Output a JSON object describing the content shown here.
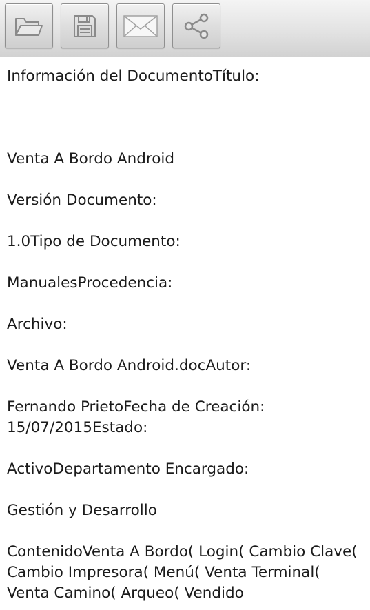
{
  "toolbar": {
    "buttons": [
      {
        "icon": "folder-open-icon",
        "action": "open"
      },
      {
        "icon": "floppy-disk-icon",
        "action": "save"
      },
      {
        "icon": "envelope-icon",
        "action": "email"
      },
      {
        "icon": "share-icon",
        "action": "share"
      }
    ],
    "colors": {
      "bar_top": "#f4f4f4",
      "bar_bottom": "#d2d2d2",
      "icon": "#8a8a8a"
    }
  },
  "document": {
    "lines": [
      "Información del DocumentoTítulo:",
      "Venta A Bordo Android",
      "Versión Documento:",
      "1.0Tipo de Documento:",
      "ManualesProcedencia:",
      "Archivo:",
      "Venta A Bordo Android.docAutor:",
      "Fernando PrietoFecha de Creación: 15/07/2015Estado:",
      "ActivoDepartamento Encargado:",
      "Gestión y Desarrollo",
      "ContenidoVenta A Bordo( Login( Cambio Clave( Cambio Impresora( Menú( Venta Terminal( Venta Camino( Arqueo( Vendido"
    ]
  }
}
